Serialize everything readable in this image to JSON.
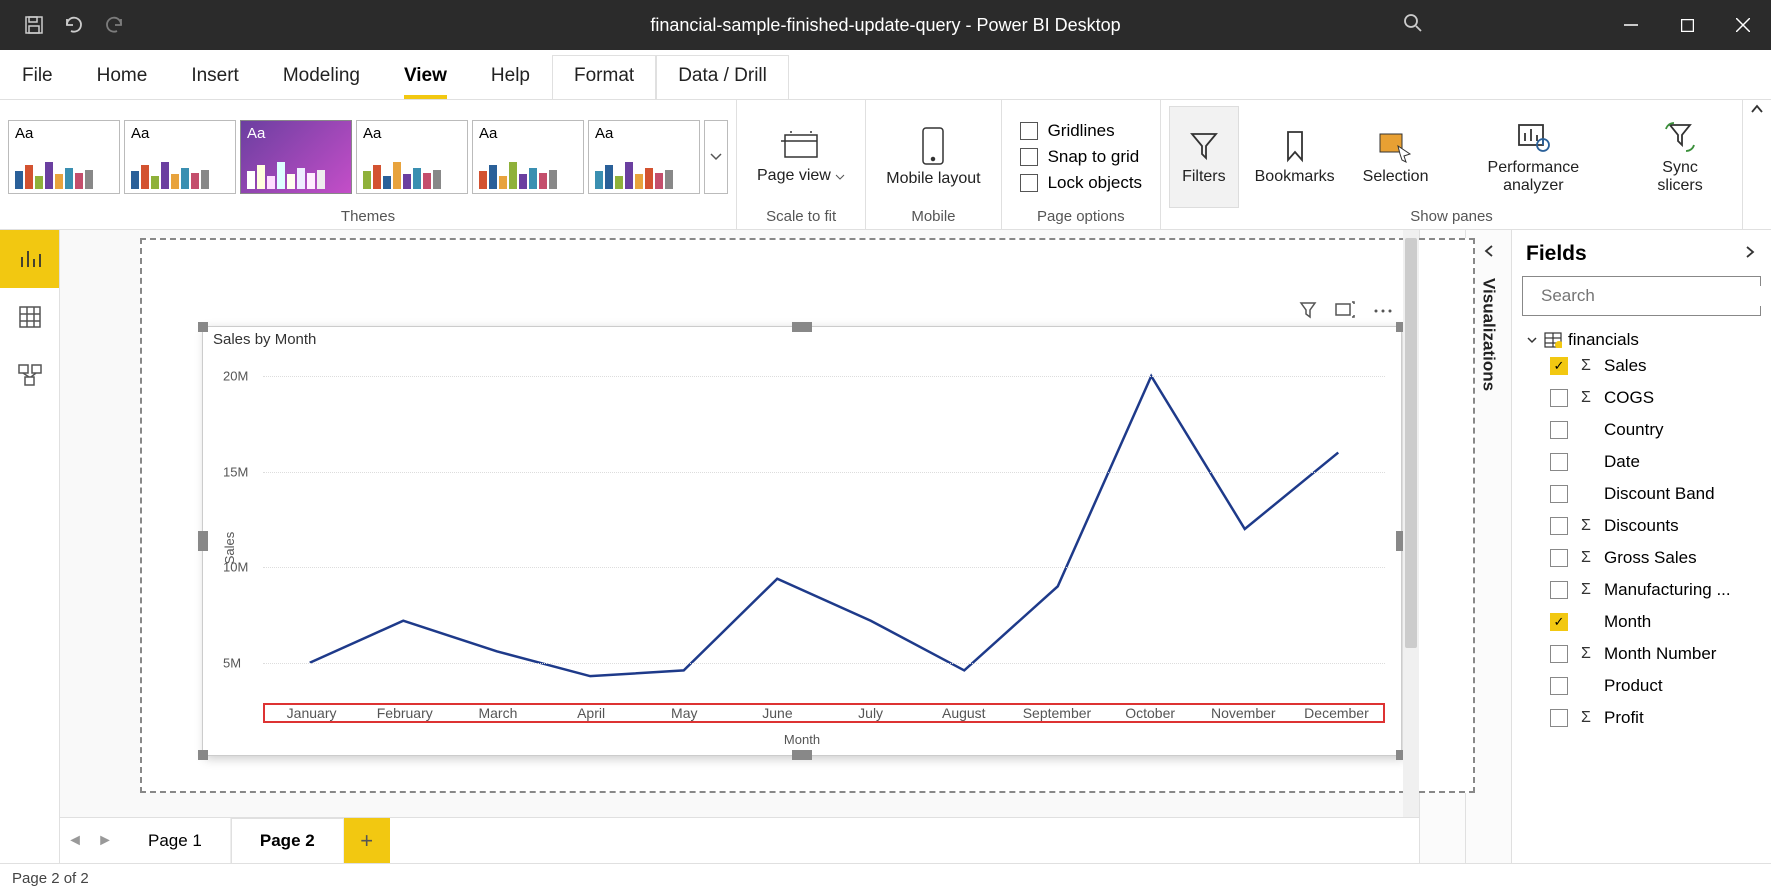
{
  "title": "financial-sample-finished-update-query - Power BI Desktop",
  "menus": {
    "file": "File",
    "home": "Home",
    "insert": "Insert",
    "modeling": "Modeling",
    "view": "View",
    "help": "Help",
    "format": "Format",
    "datadrill": "Data / Drill"
  },
  "ribbon": {
    "themes_label": "Themes",
    "page_view": "Page view",
    "mobile_layout": "Mobile layout",
    "scale_to_fit": "Scale to fit",
    "mobile": "Mobile",
    "gridlines": "Gridlines",
    "snap": "Snap to grid",
    "lock": "Lock objects",
    "page_options": "Page options",
    "filters": "Filters",
    "bookmarks": "Bookmarks",
    "selection": "Selection",
    "perf": "Performance analyzer",
    "sync": "Sync slicers",
    "show_panes": "Show panes"
  },
  "chart_data": {
    "type": "line",
    "title": "Sales by Month",
    "xlabel": "Month",
    "ylabel": "Sales",
    "categories": [
      "January",
      "February",
      "March",
      "April",
      "May",
      "June",
      "July",
      "August",
      "September",
      "October",
      "November",
      "December"
    ],
    "values": [
      5000000,
      7200000,
      5600000,
      4300000,
      4600000,
      9400000,
      7200000,
      4600000,
      9000000,
      20000000,
      12000000,
      16000000
    ],
    "y_ticks": [
      5000000,
      10000000,
      15000000,
      20000000
    ],
    "y_tick_labels": [
      "5M",
      "10M",
      "15M",
      "20M"
    ],
    "ylim": [
      3000000,
      21000000
    ]
  },
  "panes": {
    "filters": "Filters",
    "visualizations": "Visualizations",
    "fields": "Fields",
    "search": "Search"
  },
  "fields_table": "financials",
  "fields": {
    "sales": "Sales",
    "cogs": "COGS",
    "country": "Country",
    "date": "Date",
    "discount_band": "Discount Band",
    "discounts": "Discounts",
    "gross_sales": "Gross Sales",
    "manufacturing": "Manufacturing ...",
    "month": "Month",
    "month_number": "Month Number",
    "product": "Product",
    "profit": "Profit"
  },
  "pages": {
    "p1": "Page 1",
    "p2": "Page 2"
  },
  "status": "Page 2 of 2"
}
